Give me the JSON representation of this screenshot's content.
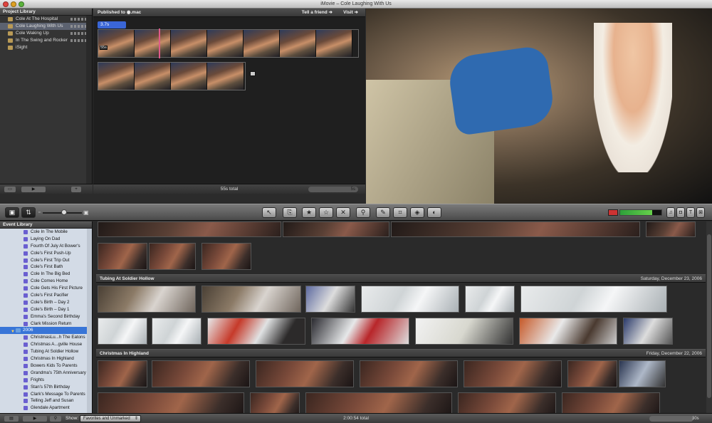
{
  "window": {
    "title": "iMovie – Cole Laughing With Us"
  },
  "project_library": {
    "title": "Project Library",
    "items": [
      {
        "label": "Cole At The Hospital",
        "selected": false
      },
      {
        "label": "Cole Laughing With Us",
        "selected": true
      },
      {
        "label": "Cole Waking Up",
        "selected": false
      },
      {
        "label": "In The Swing and Rocker",
        "selected": false
      },
      {
        "label": "iSight",
        "selected": false
      }
    ]
  },
  "project_editor": {
    "published_label": "Published to",
    "published_target": ".mac",
    "tell_friend": "Tell a friend",
    "visit": "Visit",
    "clip_duration": "3.7s",
    "clip_total_label": "55s",
    "total": "55s total",
    "zoom_label": "5s"
  },
  "toolbar": {
    "colors": {
      "meter_green": "#4fc24a"
    }
  },
  "event_library": {
    "title": "Event Library",
    "items_before": [
      "Cole In The Mobile",
      "Laying On Dad",
      "Fourth Of July At Bower's",
      "Cole's First Push-Up",
      "Cole's First Trip Out",
      "Cole's First Bath",
      "Cole In The Big Bed",
      "Cole Comes Home",
      "Cole Gets His First Picture",
      "Cole's First Pacifier",
      "Cole's Birth – Day 2",
      "Cole's Birth – Day 1",
      "Emma's Second Birthday",
      "Clark Mission Return"
    ],
    "year": "2006",
    "items_after": [
      "ChristmasLu...h The Eatons",
      "Christmas A...gville House",
      "Tubing At Soldier Hollow",
      "Christmas In Highland",
      "Bowers Kids To Parents",
      "Grandma's 75th Anniversary",
      "Frights",
      "Stan's 57th Birthday",
      "Clark's Message To Parents",
      "Telling Jeff and Susan",
      "Glendale Apartment"
    ]
  },
  "event_browser": {
    "events": [
      {
        "title": "Tubing At Soldier Hollow",
        "date": "Saturday, December 23, 2006"
      },
      {
        "title": "Christmas In Highland",
        "date": "Friday, December 22, 2006"
      }
    ]
  },
  "bottom_bar": {
    "show_label": "Show:",
    "show_value": "Favorites and Unmarked",
    "total": "2:00:54 total",
    "zoom_label": "30s"
  }
}
